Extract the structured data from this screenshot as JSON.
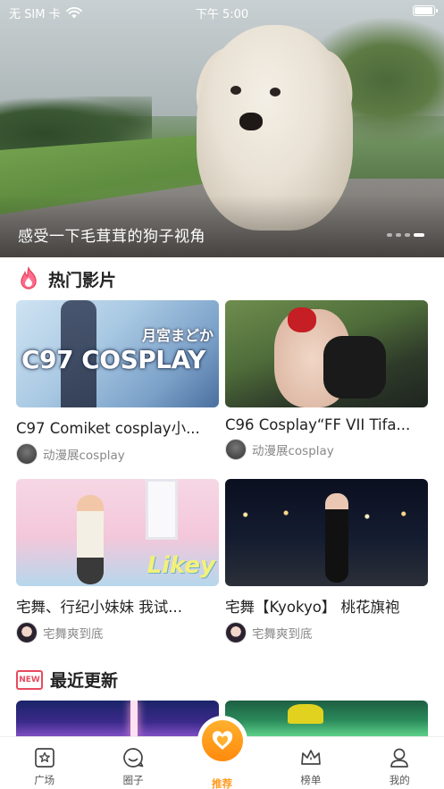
{
  "status_bar": {
    "carrier": "无 SIM 卡",
    "time": "下午 5:00"
  },
  "banner": {
    "caption": "感受一下毛茸茸的狗子视角",
    "page_count": 4,
    "active_page": 4
  },
  "hot": {
    "title": "热门影片",
    "videos": [
      {
        "title": "C97 Comiket cosplay小...",
        "author": "动漫展cosplay",
        "thumb_text_1": "月宮まどか",
        "thumb_text_2": "C97 COSPLAY"
      },
      {
        "title": "C96 Cosplay“FF VII Tifa...",
        "author": "动漫展cosplay"
      },
      {
        "title": "宅舞、行纪小妹妹 我试...",
        "author": "宅舞爽到底",
        "thumb_text": "Likey"
      },
      {
        "title": "宅舞【Kyokyo】 桃花旗袍",
        "author": "宅舞爽到底"
      }
    ]
  },
  "recent": {
    "title": "最近更新",
    "icon_text": "NEW"
  },
  "tabbar": {
    "tabs": [
      {
        "label": "广场",
        "icon": "square-star-icon"
      },
      {
        "label": "圈子",
        "icon": "chat-bubble-icon"
      },
      {
        "label": "推荐",
        "icon": "heart-icon",
        "active": true
      },
      {
        "label": "榜单",
        "icon": "crown-icon"
      },
      {
        "label": "我的",
        "icon": "user-icon"
      }
    ]
  },
  "colors": {
    "accent": "#ff9a1f",
    "new_badge": "#e84a5f"
  }
}
